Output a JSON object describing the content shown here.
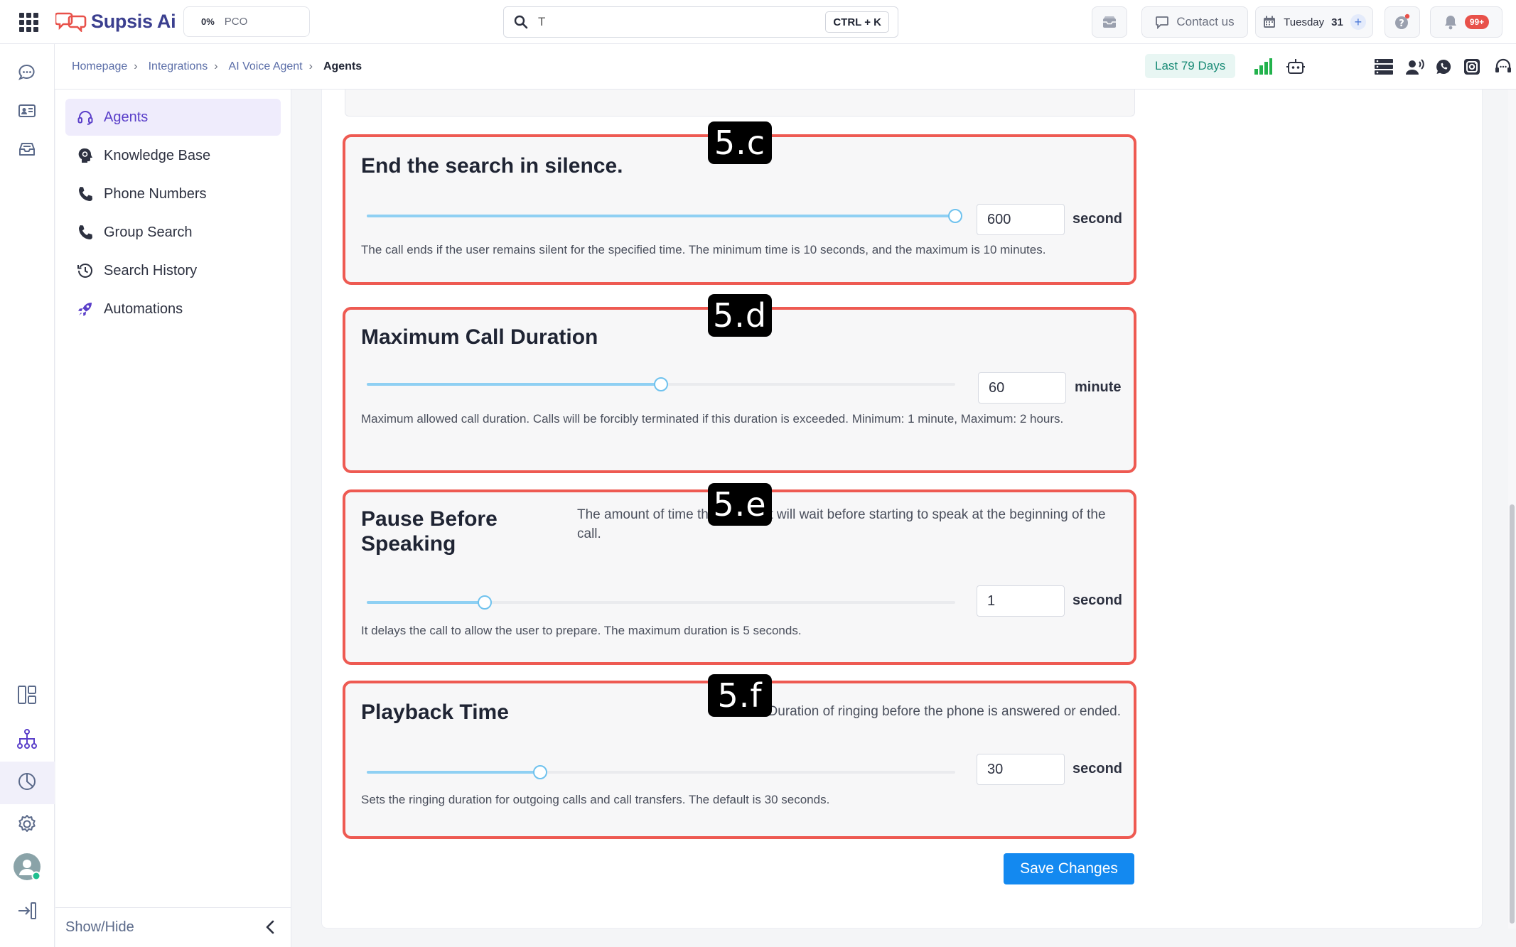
{
  "app": {
    "name": "Supsis Ai",
    "pco_percent": "0%",
    "pco_label": "PCO"
  },
  "search": {
    "value": "T",
    "shortcut": "CTRL + K"
  },
  "topbar": {
    "contact_label": "Contact us",
    "date_day": "Tuesday",
    "date_num": "31",
    "notifications_badge": "99+"
  },
  "breadcrumb": {
    "items": [
      "Homepage",
      "Integrations",
      "AI Voice Agent"
    ],
    "current": "Agents",
    "separator": "›",
    "date_range": "Last 79 Days"
  },
  "subnav": {
    "items": [
      {
        "label": "Agents",
        "icon": "headset-icon",
        "active": true
      },
      {
        "label": "Knowledge Base",
        "icon": "brain-icon"
      },
      {
        "label": "Phone Numbers",
        "icon": "phone-icon"
      },
      {
        "label": "Group Search",
        "icon": "phone-icon"
      },
      {
        "label": "Search History",
        "icon": "history-icon"
      },
      {
        "label": "Automations",
        "icon": "rocket-icon"
      }
    ],
    "show_hide": "Show/Hide"
  },
  "sections": {
    "silence": {
      "tag": "5.c",
      "title": "End the search in silence.",
      "value": "600",
      "unit": "second",
      "fill_fraction": 1.0,
      "help": "The call ends if the user remains silent for the specified time. The minimum time is 10 seconds, and the maximum is 10 minutes."
    },
    "max_duration": {
      "tag": "5.d",
      "title": "Maximum Call Duration",
      "value": "60",
      "unit": "minute",
      "fill_fraction": 0.5,
      "help": "Maximum allowed call duration. Calls will be forcibly terminated if this duration is exceeded. Minimum: 1 minute, Maximum: 2 hours."
    },
    "pause": {
      "tag": "5.e",
      "title": "Pause Before Speaking",
      "description": "The amount of time the assistant will wait before starting to speak at the beginning of the call.",
      "value": "1",
      "unit": "second",
      "fill_fraction": 0.2,
      "help": "It delays the call to allow the user to prepare. The maximum duration is 5 seconds."
    },
    "playback": {
      "tag": "5.f",
      "title": "Playback Time",
      "description": "Duration of ringing before the phone is answered or ended.",
      "value": "30",
      "unit": "second",
      "fill_fraction": 0.295,
      "help": "Sets the ringing duration for outgoing calls and call transfers. The default is 30 seconds."
    }
  },
  "actions": {
    "save_label": "Save Changes"
  },
  "colors": {
    "accent": "#5a3fc9",
    "annotation_border": "#ee5a52",
    "slider_fill": "#8fd0f3",
    "primary_button": "#1389f0"
  }
}
